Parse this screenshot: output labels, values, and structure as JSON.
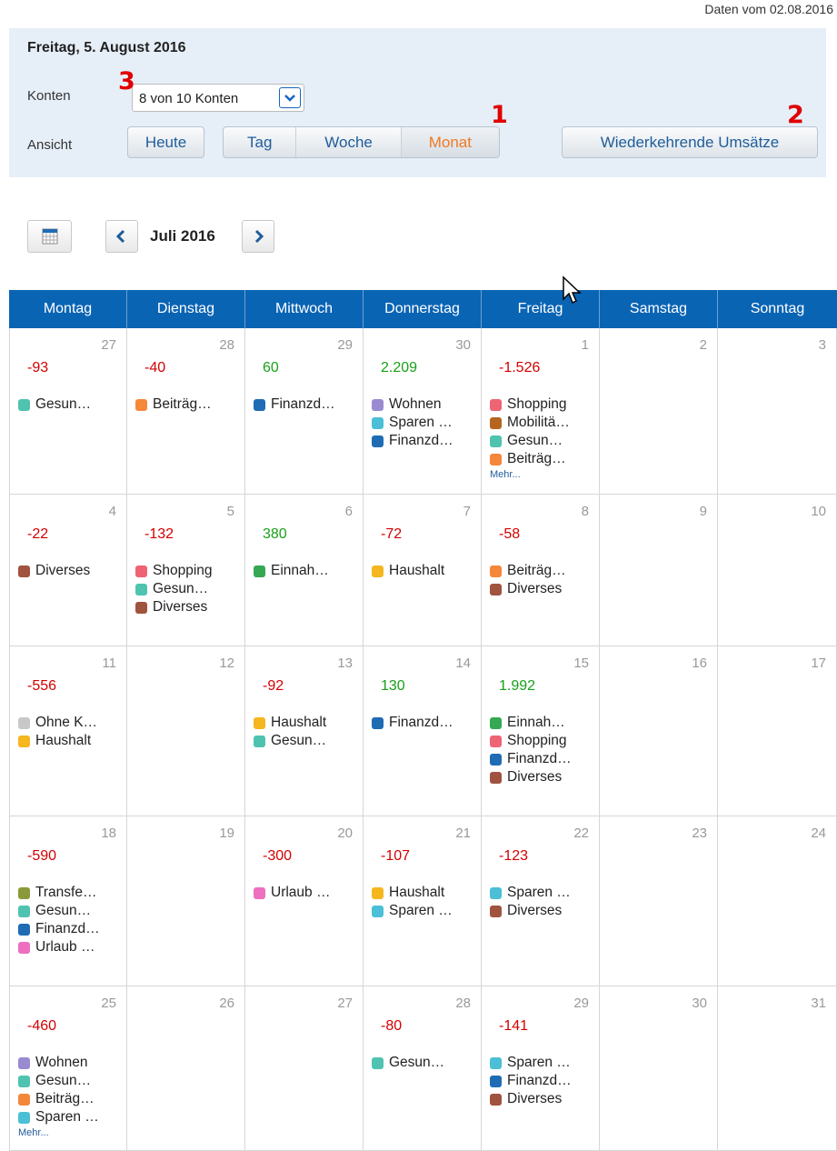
{
  "data_date": "Daten vom 02.08.2016",
  "header": {
    "current_date": "Freitag, 5. August 2016",
    "konten_label": "Konten",
    "konten_value": "8 von 10 Konten",
    "ansicht_label": "Ansicht",
    "heute": "Heute",
    "views": [
      "Tag",
      "Woche",
      "Monat"
    ],
    "active_view": "Monat",
    "recurring": "Wiederkehrende Umsätze",
    "annotations": [
      "1",
      "2",
      "3"
    ]
  },
  "nav": {
    "month": "Juli 2016"
  },
  "colors": {
    "Gesundheit": "#4fc3b0",
    "Beiträge": "#f5873a",
    "Finanzdienstleistungen": "#1f6cb5",
    "Wohnen": "#9a8bd0",
    "Sparen": "#4bbfd6",
    "Shopping": "#ef6474",
    "Mobilität": "#b5651d",
    "Diverses": "#a0533e",
    "Einnahmen": "#34a853",
    "Haushalt": "#f5b61e",
    "Ohne Kategorie": "#c8c8c8",
    "Transfer": "#8a9a3a",
    "Urlaub": "#ee6fbf"
  },
  "calendar": {
    "weekdays": [
      "Montag",
      "Dienstag",
      "Mittwoch",
      "Donnerstag",
      "Freitag",
      "Samstag",
      "Sonntag"
    ],
    "more_label": "Mehr...",
    "weeks": [
      [
        {
          "day": "27",
          "amount": "-93",
          "cats": [
            [
              "Gesun…",
              "Gesundheit"
            ]
          ]
        },
        {
          "day": "28",
          "amount": "-40",
          "cats": [
            [
              "Beiträg…",
              "Beiträge"
            ]
          ]
        },
        {
          "day": "29",
          "amount": "60",
          "cats": [
            [
              "Finanzd…",
              "Finanzdienstleistungen"
            ]
          ]
        },
        {
          "day": "30",
          "amount": "2.209",
          "cats": [
            [
              "Wohnen",
              "Wohnen"
            ],
            [
              "Sparen …",
              "Sparen"
            ],
            [
              "Finanzd…",
              "Finanzdienstleistungen"
            ]
          ]
        },
        {
          "day": "1",
          "amount": "-1.526",
          "cats": [
            [
              "Shopping",
              "Shopping"
            ],
            [
              "Mobilitä…",
              "Mobilität"
            ],
            [
              "Gesun…",
              "Gesundheit"
            ],
            [
              "Beiträg…",
              "Beiträge"
            ]
          ],
          "more": true
        },
        {
          "day": "2"
        },
        {
          "day": "3"
        }
      ],
      [
        {
          "day": "4",
          "amount": "-22",
          "cats": [
            [
              "Diverses",
              "Diverses"
            ]
          ]
        },
        {
          "day": "5",
          "amount": "-132",
          "cats": [
            [
              "Shopping",
              "Shopping"
            ],
            [
              "Gesun…",
              "Gesundheit"
            ],
            [
              "Diverses",
              "Diverses"
            ]
          ]
        },
        {
          "day": "6",
          "amount": "380",
          "cats": [
            [
              "Einnah…",
              "Einnahmen"
            ]
          ]
        },
        {
          "day": "7",
          "amount": "-72",
          "cats": [
            [
              "Haushalt",
              "Haushalt"
            ]
          ]
        },
        {
          "day": "8",
          "amount": "-58",
          "cats": [
            [
              "Beiträg…",
              "Beiträge"
            ],
            [
              "Diverses",
              "Diverses"
            ]
          ]
        },
        {
          "day": "9"
        },
        {
          "day": "10"
        }
      ],
      [
        {
          "day": "11",
          "amount": "-556",
          "cats": [
            [
              "Ohne K…",
              "Ohne Kategorie"
            ],
            [
              "Haushalt",
              "Haushalt"
            ]
          ]
        },
        {
          "day": "12"
        },
        {
          "day": "13",
          "amount": "-92",
          "cats": [
            [
              "Haushalt",
              "Haushalt"
            ],
            [
              "Gesun…",
              "Gesundheit"
            ]
          ]
        },
        {
          "day": "14",
          "amount": "130",
          "cats": [
            [
              "Finanzd…",
              "Finanzdienstleistungen"
            ]
          ]
        },
        {
          "day": "15",
          "amount": "1.992",
          "cats": [
            [
              "Einnah…",
              "Einnahmen"
            ],
            [
              "Shopping",
              "Shopping"
            ],
            [
              "Finanzd…",
              "Finanzdienstleistungen"
            ],
            [
              "Diverses",
              "Diverses"
            ]
          ]
        },
        {
          "day": "16"
        },
        {
          "day": "17"
        }
      ],
      [
        {
          "day": "18",
          "amount": "-590",
          "cats": [
            [
              "Transfe…",
              "Transfer"
            ],
            [
              "Gesun…",
              "Gesundheit"
            ],
            [
              "Finanzd…",
              "Finanzdienstleistungen"
            ],
            [
              "Urlaub …",
              "Urlaub"
            ]
          ]
        },
        {
          "day": "19"
        },
        {
          "day": "20",
          "amount": "-300",
          "cats": [
            [
              "Urlaub …",
              "Urlaub"
            ]
          ]
        },
        {
          "day": "21",
          "amount": "-107",
          "cats": [
            [
              "Haushalt",
              "Haushalt"
            ],
            [
              "Sparen …",
              "Sparen"
            ]
          ]
        },
        {
          "day": "22",
          "amount": "-123",
          "cats": [
            [
              "Sparen …",
              "Sparen"
            ],
            [
              "Diverses",
              "Diverses"
            ]
          ]
        },
        {
          "day": "23"
        },
        {
          "day": "24"
        }
      ],
      [
        {
          "day": "25",
          "amount": "-460",
          "cats": [
            [
              "Wohnen",
              "Wohnen"
            ],
            [
              "Gesun…",
              "Gesundheit"
            ],
            [
              "Beiträg…",
              "Beiträge"
            ],
            [
              "Sparen …",
              "Sparen"
            ]
          ],
          "more": true
        },
        {
          "day": "26"
        },
        {
          "day": "27"
        },
        {
          "day": "28",
          "amount": "-80",
          "cats": [
            [
              "Gesun…",
              "Gesundheit"
            ]
          ]
        },
        {
          "day": "29",
          "amount": "-141",
          "cats": [
            [
              "Sparen …",
              "Sparen"
            ],
            [
              "Finanzd…",
              "Finanzdienstleistungen"
            ],
            [
              "Diverses",
              "Diverses"
            ]
          ]
        },
        {
          "day": "30"
        },
        {
          "day": "31"
        }
      ]
    ]
  }
}
